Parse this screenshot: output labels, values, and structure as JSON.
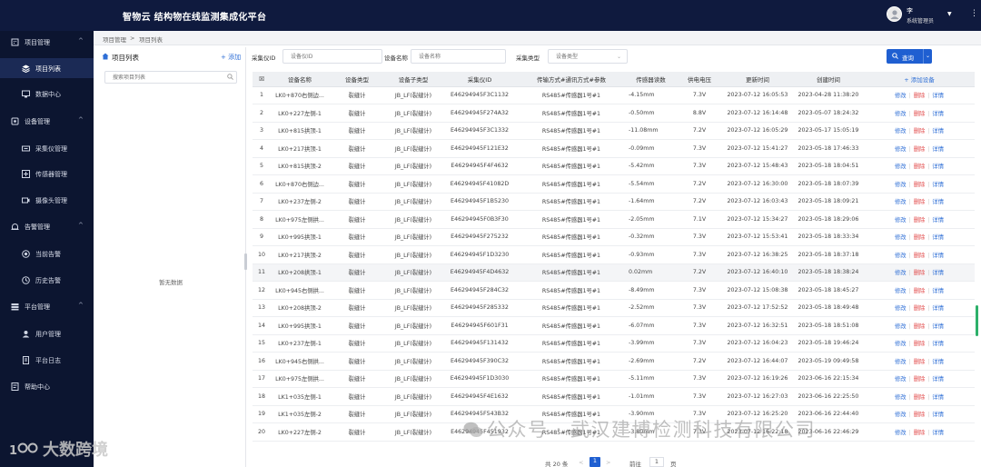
{
  "header": {
    "app_title": "智物云 结构物在线监测集成化平台",
    "user_name": "李",
    "user_role": "系统管理员"
  },
  "sidebar": {
    "items": [
      {
        "label": "项目管理",
        "type": "group",
        "icon": "building-icon"
      },
      {
        "label": "项目列表",
        "type": "item",
        "icon": "layers-icon",
        "active": true
      },
      {
        "label": "数据中心",
        "type": "item",
        "icon": "monitor-icon"
      },
      {
        "label": "设备管理",
        "type": "group",
        "icon": "device-icon"
      },
      {
        "label": "采集仪管理",
        "type": "item",
        "icon": "collector-icon"
      },
      {
        "label": "传感器管理",
        "type": "item",
        "icon": "sensor-icon"
      },
      {
        "label": "摄像头管理",
        "type": "item",
        "icon": "camera-icon"
      },
      {
        "label": "告警管理",
        "type": "group",
        "icon": "alarm-icon"
      },
      {
        "label": "当前告警",
        "type": "item",
        "icon": "alert-icon"
      },
      {
        "label": "历史告警",
        "type": "item",
        "icon": "history-icon"
      },
      {
        "label": "平台管理",
        "type": "group",
        "icon": "platform-icon"
      },
      {
        "label": "用户管理",
        "type": "item",
        "icon": "user-icon"
      },
      {
        "label": "平台日志",
        "type": "item",
        "icon": "log-icon"
      },
      {
        "label": "帮助中心",
        "type": "group",
        "icon": "help-icon"
      }
    ]
  },
  "breadcrumb": {
    "level1": "项目管理",
    "separator": ">",
    "level2": "项目列表"
  },
  "project_panel": {
    "title": "项目列表",
    "add_label": "+ 添加",
    "search_placeholder": "搜索项目列表",
    "empty_text": "暂无数据"
  },
  "filters": {
    "collector_id_label": "采集仪ID",
    "collector_id_placeholder": "设备仪ID",
    "device_name_label": "设备名称",
    "device_name_placeholder": "设备名称",
    "collector_type_label": "采集类型",
    "collector_type_placeholder": "设备类型",
    "query_label": "查询"
  },
  "table": {
    "headers": [
      "设备名称",
      "设备类型",
      "设备子类型",
      "采集仪ID",
      "传输方式#通讯方式#参数",
      "传感器读数",
      "供电电压",
      "更新时间",
      "创建时间"
    ],
    "add_device_label": "+ 添加设备",
    "action_edit": "修改",
    "action_delete": "删除",
    "action_detail": "详情",
    "rows": [
      {
        "no": "1",
        "name": "LK0+870右侧边...",
        "type": "裂缝计",
        "subtype": "JB_LF(裂缝计)",
        "cid": "E46294945F3C1132",
        "trans": "RS485#传感器1号#1",
        "reading": "-4.15mm",
        "voltage": "7.3V",
        "updated": "2023-07-12 16:05:53",
        "created": "2023-04-28 11:38:20"
      },
      {
        "no": "2",
        "name": "LK0+227左侧-1",
        "type": "裂缝计",
        "subtype": "JB_LF(裂缝计)",
        "cid": "E46294945F274A32",
        "trans": "RS485#传感器1号#1",
        "reading": "-0.50mm",
        "voltage": "8.8V",
        "updated": "2023-07-12 16:14:48",
        "created": "2023-05-07 18:24:32"
      },
      {
        "no": "3",
        "name": "LK0+815拱顶-1",
        "type": "裂缝计",
        "subtype": "JB_LF(裂缝计)",
        "cid": "E46294945F3C1332",
        "trans": "RS485#传感器1号#1",
        "reading": "-11.08mm",
        "voltage": "7.2V",
        "updated": "2023-07-12 16:05:29",
        "created": "2023-05-17 15:05:19"
      },
      {
        "no": "4",
        "name": "LK0+217拱顶-1",
        "type": "裂缝计",
        "subtype": "JB_LF(裂缝计)",
        "cid": "E46294945F121E32",
        "trans": "RS485#传感器1号#1",
        "reading": "-0.09mm",
        "voltage": "7.3V",
        "updated": "2023-07-12 15:41:27",
        "created": "2023-05-18 17:46:33"
      },
      {
        "no": "5",
        "name": "LK0+815拱顶-2",
        "type": "裂缝计",
        "subtype": "JB_LF(裂缝计)",
        "cid": "E46294945F4F4632",
        "trans": "RS485#传感器1号#1",
        "reading": "-5.42mm",
        "voltage": "7.3V",
        "updated": "2023-07-12 15:48:43",
        "created": "2023-05-18 18:04:51"
      },
      {
        "no": "6",
        "name": "LK0+870右侧边...",
        "type": "裂缝计",
        "subtype": "JB_LF(裂缝计)",
        "cid": "E46294945F41082D",
        "trans": "RS485#传感器1号#1",
        "reading": "-5.54mm",
        "voltage": "7.2V",
        "updated": "2023-07-12 16:30:00",
        "created": "2023-05-18 18:07:39"
      },
      {
        "no": "7",
        "name": "LK0+237左侧-2",
        "type": "裂缝计",
        "subtype": "JB_LF(裂缝计)",
        "cid": "E46294945F1B5230",
        "trans": "RS485#传感器1号#1",
        "reading": "-1.64mm",
        "voltage": "7.2V",
        "updated": "2023-07-12 16:03:43",
        "created": "2023-05-18 18:09:21"
      },
      {
        "no": "8",
        "name": "LK0+975左侧拱...",
        "type": "裂缝计",
        "subtype": "JB_LF(裂缝计)",
        "cid": "E46294945F0B3F30",
        "trans": "RS485#传感器1号#1",
        "reading": "-2.05mm",
        "voltage": "7.1V",
        "updated": "2023-07-12 15:34:27",
        "created": "2023-05-18 18:29:06"
      },
      {
        "no": "9",
        "name": "LK0+995拱顶-1",
        "type": "裂缝计",
        "subtype": "JB_LF(裂缝计)",
        "cid": "E46294945F275232",
        "trans": "RS485#传感器1号#1",
        "reading": "-0.32mm",
        "voltage": "7.3V",
        "updated": "2023-07-12 15:53:41",
        "created": "2023-05-18 18:33:34"
      },
      {
        "no": "10",
        "name": "LK0+217拱顶-2",
        "type": "裂缝计",
        "subtype": "JB_LF(裂缝计)",
        "cid": "E46294945F1D3230",
        "trans": "RS485#传感器1号#1",
        "reading": "-0.93mm",
        "voltage": "7.3V",
        "updated": "2023-07-12 16:38:25",
        "created": "2023-05-18 18:37:18"
      },
      {
        "no": "11",
        "name": "LK0+208拱顶-1",
        "type": "裂缝计",
        "subtype": "JB_LF(裂缝计)",
        "cid": "E46294945F4D4632",
        "trans": "RS485#传感器1号#1",
        "reading": "0.02mm",
        "voltage": "7.2V",
        "updated": "2023-07-12 16:40:10",
        "created": "2023-05-18 18:38:24"
      },
      {
        "no": "12",
        "name": "LK0+945右侧拱...",
        "type": "裂缝计",
        "subtype": "JB_LF(裂缝计)",
        "cid": "E46294945F284C32",
        "trans": "RS485#传感器1号#1",
        "reading": "-8.49mm",
        "voltage": "7.3V",
        "updated": "2023-07-12 15:08:38",
        "created": "2023-05-18 18:45:27"
      },
      {
        "no": "13",
        "name": "LK0+208拱顶-2",
        "type": "裂缝计",
        "subtype": "JB_LF(裂缝计)",
        "cid": "E46294945F285332",
        "trans": "RS485#传感器1号#1",
        "reading": "-2.52mm",
        "voltage": "7.3V",
        "updated": "2023-07-12 17:52:52",
        "created": "2023-05-18 18:49:48"
      },
      {
        "no": "14",
        "name": "LK0+995拱顶-1",
        "type": "裂缝计",
        "subtype": "JB_LF(裂缝计)",
        "cid": "E46294945F601F31",
        "trans": "RS485#传感器1号#1",
        "reading": "-6.07mm",
        "voltage": "7.3V",
        "updated": "2023-07-12 16:32:51",
        "created": "2023-05-18 18:51:08"
      },
      {
        "no": "15",
        "name": "LK0+237左侧-1",
        "type": "裂缝计",
        "subtype": "JB_LF(裂缝计)",
        "cid": "E46294945F131432",
        "trans": "RS485#传感器1号#1",
        "reading": "-3.99mm",
        "voltage": "7.3V",
        "updated": "2023-07-12 16:04:23",
        "created": "2023-05-18 19:46:24"
      },
      {
        "no": "16",
        "name": "LK0+945右侧拱...",
        "type": "裂缝计",
        "subtype": "JB_LF(裂缝计)",
        "cid": "E46294945F390C32",
        "trans": "RS485#传感器1号#1",
        "reading": "-2.69mm",
        "voltage": "7.2V",
        "updated": "2023-07-12 16:44:07",
        "created": "2023-05-19 09:49:58"
      },
      {
        "no": "17",
        "name": "LK0+975左侧拱...",
        "type": "裂缝计",
        "subtype": "JB_LF(裂缝计)",
        "cid": "E46294945F1D3030",
        "trans": "RS485#传感器1号#1",
        "reading": "-5.11mm",
        "voltage": "7.3V",
        "updated": "2023-07-12 16:19:26",
        "created": "2023-06-16 22:15:34"
      },
      {
        "no": "18",
        "name": "LK1+035左侧-1",
        "type": "裂缝计",
        "subtype": "JB_LF(裂缝计)",
        "cid": "E46294945F4E1632",
        "trans": "RS485#传感器1号#1",
        "reading": "-1.01mm",
        "voltage": "7.3V",
        "updated": "2023-07-12 16:27:03",
        "created": "2023-06-16 22:25:50"
      },
      {
        "no": "19",
        "name": "LK1+035左侧-2",
        "type": "裂缝计",
        "subtype": "JB_LF(裂缝计)",
        "cid": "E46294945F543B32",
        "trans": "RS485#传感器1号#1",
        "reading": "-3.90mm",
        "voltage": "7.3V",
        "updated": "2023-07-12 16:25:20",
        "created": "2023-06-16 22:44:40"
      },
      {
        "no": "20",
        "name": "LK0+227左侧-2",
        "type": "裂缝计",
        "subtype": "JB_LF(裂缝计)",
        "cid": "E46294945F451932",
        "trans": "RS485#传感器1号#1",
        "reading": "-3.80mm",
        "voltage": "7.3V",
        "updated": "2023-07-12 16:22:18",
        "created": "2023-06-16 22:46:29"
      }
    ]
  },
  "pagination": {
    "total": "共 20 条",
    "prev": "<",
    "current": "1",
    "next": ">",
    "goto_label": "前往",
    "goto_value": "1",
    "page_suffix": "页"
  },
  "watermarks": {
    "wechat": "公众号 · 武汉建博检测科技有限公司",
    "corner": "大数跨境"
  },
  "colors": {
    "topbar": "#0f1a3e",
    "sidebar": "#0c1530",
    "primary": "#1f5fd1",
    "danger": "#e24a4a"
  }
}
